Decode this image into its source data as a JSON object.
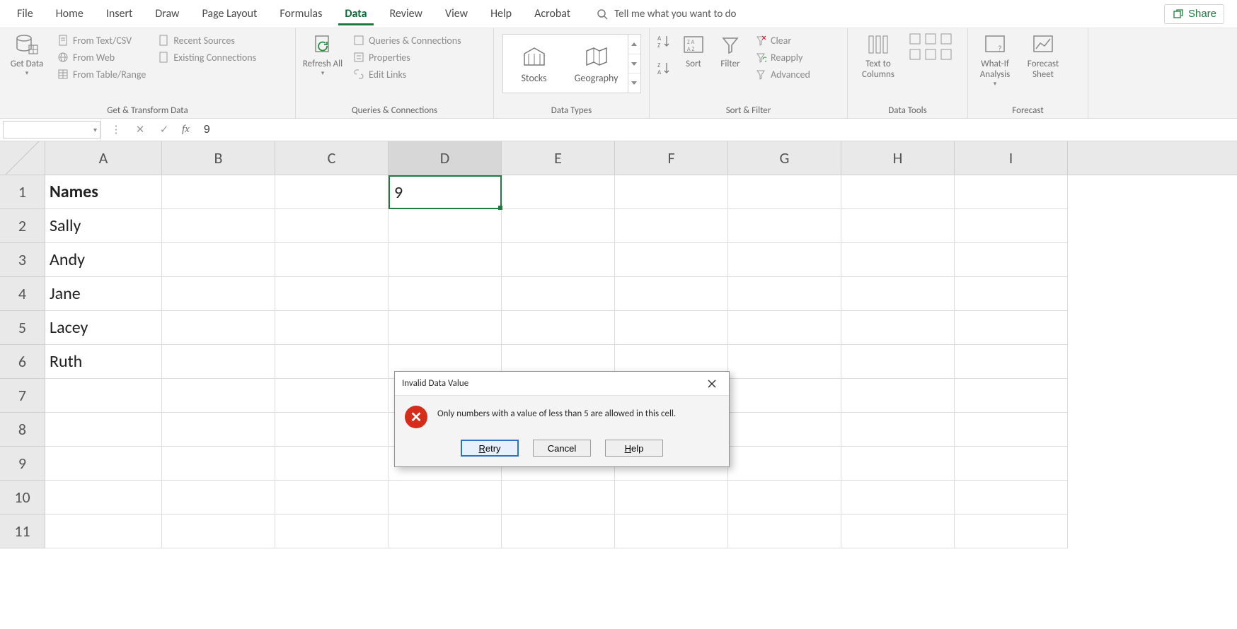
{
  "tabs": [
    "File",
    "Home",
    "Insert",
    "Draw",
    "Page Layout",
    "Formulas",
    "Data",
    "Review",
    "View",
    "Help",
    "Acrobat"
  ],
  "active_tab": "Data",
  "tellme_placeholder": "Tell me what you want to do",
  "share_label": "Share",
  "ribbon": {
    "groups": {
      "get_transform": {
        "label": "Get & Transform Data",
        "get_data": "Get Data",
        "from_text_csv": "From Text/CSV",
        "from_web": "From Web",
        "from_table": "From Table/Range",
        "recent_sources": "Recent Sources",
        "existing_connections": "Existing Connections"
      },
      "queries_conn": {
        "label": "Queries & Connections",
        "refresh_all": "Refresh All",
        "queries_connections": "Queries & Connections",
        "properties": "Properties",
        "edit_links": "Edit Links"
      },
      "data_types": {
        "label": "Data Types",
        "stocks": "Stocks",
        "geography": "Geography"
      },
      "sort_filter": {
        "label": "Sort & Filter",
        "sort": "Sort",
        "filter": "Filter",
        "clear": "Clear",
        "reapply": "Reapply",
        "advanced": "Advanced"
      },
      "data_tools": {
        "label": "Data Tools",
        "text_to_columns": "Text to Columns"
      },
      "forecast": {
        "label": "Forecast",
        "what_if": "What-If Analysis",
        "forecast_sheet": "Forecast Sheet"
      }
    }
  },
  "formula_bar": {
    "name_box_value": "",
    "fx_label": "fx",
    "value": "9"
  },
  "columns": [
    "A",
    "B",
    "C",
    "D",
    "E",
    "F",
    "G",
    "H",
    "I"
  ],
  "active_column": "D",
  "rows": [
    1,
    2,
    3,
    4,
    5,
    6,
    7,
    8,
    9,
    10,
    11
  ],
  "cells": {
    "A1": "Names",
    "A2": "Sally",
    "A3": "Andy",
    "A4": "Jane",
    "A5": "Lacey",
    "A6": "Ruth",
    "D1": "9"
  },
  "selected_cell": "D1",
  "dialog": {
    "title": "Invalid Data Value",
    "message": "Only numbers with a value of less than 5 are allowed in this cell.",
    "retry": "Retry",
    "cancel": "Cancel",
    "help": "Help"
  }
}
